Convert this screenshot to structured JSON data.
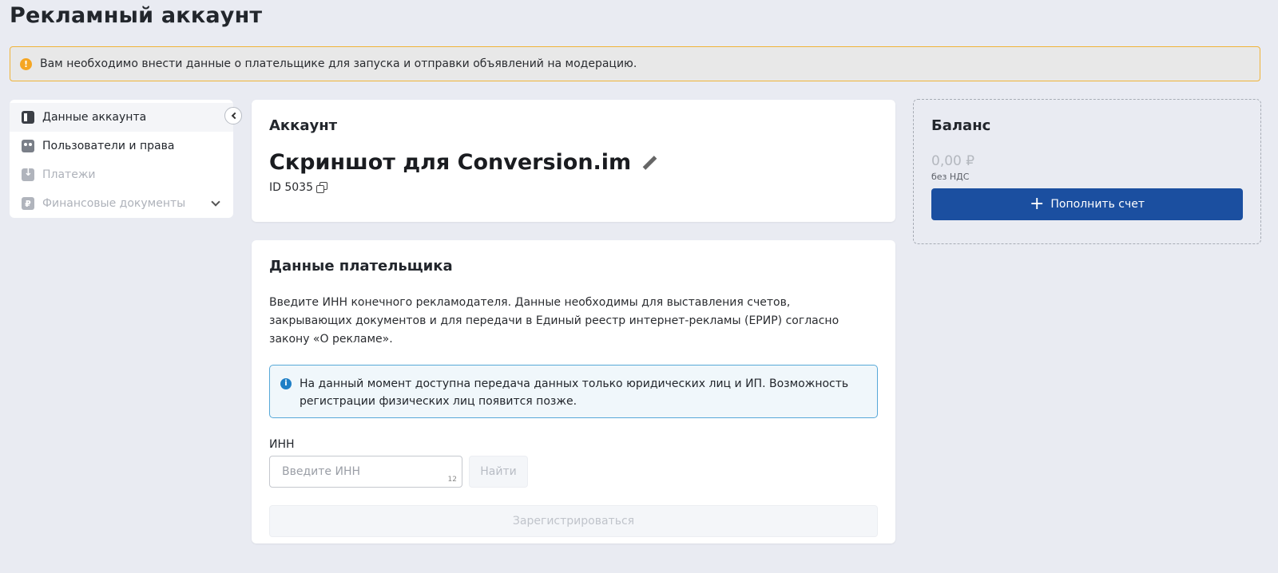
{
  "page": {
    "title": "Рекламный аккаунт"
  },
  "alert": {
    "text": "Вам необходимо внести данные о плательщике для запуска и отправки объявлений на модерацию.",
    "icon": "warning-icon",
    "icon_glyph": "!"
  },
  "sidebar": {
    "items": [
      {
        "label": "Данные аккаунта",
        "icon": "account-icon",
        "active": true
      },
      {
        "label": "Пользователи и права",
        "icon": "users-icon"
      },
      {
        "label": "Платежи",
        "icon": "payments-icon",
        "disabled": true
      },
      {
        "label": "Финансовые документы",
        "icon": "ruble-icon",
        "icon_glyph": "₽",
        "disabled": true
      }
    ]
  },
  "account": {
    "heading": "Аккаунт",
    "name": "Скриншот для Conversion.im",
    "id_text": "ID 5035"
  },
  "payer": {
    "heading": "Данные плательщика",
    "description": "Введите ИНН конечного рекламодателя. Данные необходимы для выставления счетов, закрывающих документов и для передачи в Единый реестр интернет-рекламы (ЕРИР) согласно закону «О рекламе».",
    "info": "На данный момент доступна передача данных только юридических лиц и ИП. Возможность регистрации физических лиц появится позже.",
    "info_glyph": "i",
    "inn_label": "ИНН",
    "inn_placeholder": "Введите ИНН",
    "inn_counter": "12",
    "find_label": "Найти",
    "register_label": "Зарегистрироваться"
  },
  "balance": {
    "heading": "Баланс",
    "amount": "0,00 ₽",
    "vat_note": "без НДС",
    "topup_label": "Пополнить счет",
    "topup_glyph": "+"
  },
  "colors": {
    "primary": "#1b4fa0",
    "warning": "#f0b43a",
    "info": "#57a8d8",
    "background": "#e9ebf2"
  }
}
